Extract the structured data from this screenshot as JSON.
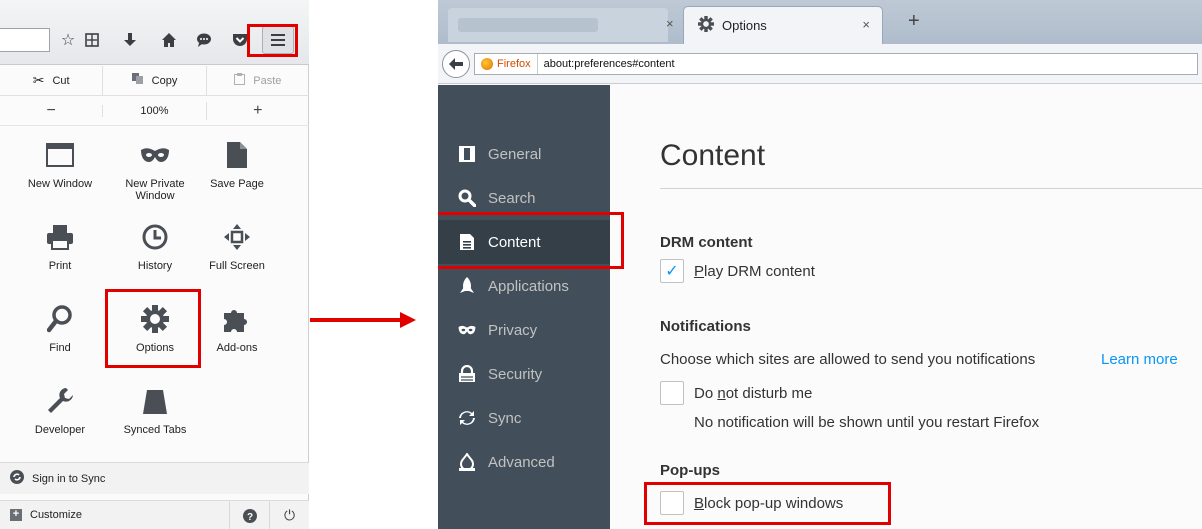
{
  "menu": {
    "edit": {
      "cut": "Cut",
      "copy": "Copy",
      "paste": "Paste"
    },
    "zoom": {
      "minus": "−",
      "level": "100%",
      "plus": "+"
    },
    "items": [
      {
        "label": "New Window",
        "icon": "new-window-icon"
      },
      {
        "label": "New Private Window",
        "icon": "mask-icon"
      },
      {
        "label": "Save Page",
        "icon": "save-page-icon"
      },
      {
        "label": "Print",
        "icon": "print-icon"
      },
      {
        "label": "History",
        "icon": "history-icon"
      },
      {
        "label": "Full Screen",
        "icon": "full-screen-icon"
      },
      {
        "label": "Find",
        "icon": "find-icon"
      },
      {
        "label": "Options",
        "icon": "gear-icon"
      },
      {
        "label": "Add-ons",
        "icon": "puzzle-icon"
      },
      {
        "label": "Developer",
        "icon": "wrench-icon"
      },
      {
        "label": "Synced Tabs",
        "icon": "synced-tabs-icon"
      }
    ],
    "sign_in": "Sign in to Sync",
    "customize": "Customize",
    "customize_symbol": "+",
    "help_symbol": "?",
    "quit_symbol": "⏻"
  },
  "browser": {
    "tab_title": "Options",
    "tab_close": "×",
    "new_tab": "+",
    "identity": "Firefox",
    "url": "about:preferences#content"
  },
  "prefs": {
    "sidebar": [
      {
        "label": "General",
        "icon": "general-icon"
      },
      {
        "label": "Search",
        "icon": "search-icon"
      },
      {
        "label": "Content",
        "icon": "content-icon",
        "selected": true
      },
      {
        "label": "Applications",
        "icon": "rocket-icon"
      },
      {
        "label": "Privacy",
        "icon": "mask-icon"
      },
      {
        "label": "Security",
        "icon": "lock-icon"
      },
      {
        "label": "Sync",
        "icon": "sync-icon"
      },
      {
        "label": "Advanced",
        "icon": "advanced-icon"
      }
    ],
    "title": "Content",
    "drm": {
      "heading": "DRM content",
      "play_pre": "",
      "play_u": "P",
      "play_post": "lay DRM content",
      "checked": true
    },
    "notifications": {
      "heading": "Notifications",
      "desc": "Choose which sites are allowed to send you notifications",
      "learn_more": "Learn more",
      "dnd_pre": "Do ",
      "dnd_u": "n",
      "dnd_post": "ot disturb me",
      "dnd_note": "No notification will be shown until you restart Firefox"
    },
    "popups": {
      "heading": "Pop-ups",
      "block_u": "B",
      "block_post": "lock pop-up windows"
    }
  },
  "colors": {
    "highlight": "#e00000",
    "sidebar_bg": "#424f5a",
    "link": "#0996f8"
  }
}
